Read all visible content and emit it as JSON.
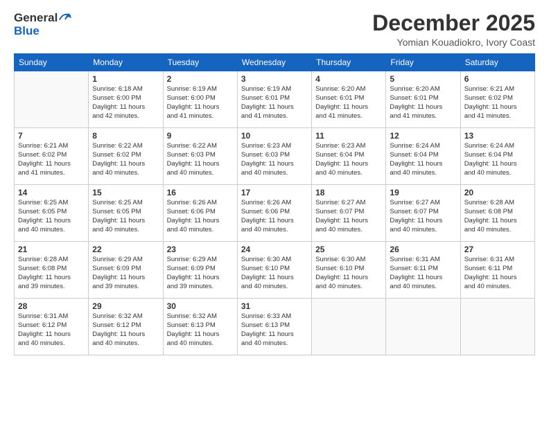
{
  "header": {
    "logo_line1": "General",
    "logo_line2": "Blue",
    "month_title": "December 2025",
    "location": "Yomian Kouadiokro, Ivory Coast"
  },
  "days_of_week": [
    "Sunday",
    "Monday",
    "Tuesday",
    "Wednesday",
    "Thursday",
    "Friday",
    "Saturday"
  ],
  "weeks": [
    [
      {
        "day": "",
        "info": ""
      },
      {
        "day": "1",
        "info": "Sunrise: 6:18 AM\nSunset: 6:00 PM\nDaylight: 11 hours\nand 42 minutes."
      },
      {
        "day": "2",
        "info": "Sunrise: 6:19 AM\nSunset: 6:00 PM\nDaylight: 11 hours\nand 41 minutes."
      },
      {
        "day": "3",
        "info": "Sunrise: 6:19 AM\nSunset: 6:01 PM\nDaylight: 11 hours\nand 41 minutes."
      },
      {
        "day": "4",
        "info": "Sunrise: 6:20 AM\nSunset: 6:01 PM\nDaylight: 11 hours\nand 41 minutes."
      },
      {
        "day": "5",
        "info": "Sunrise: 6:20 AM\nSunset: 6:01 PM\nDaylight: 11 hours\nand 41 minutes."
      },
      {
        "day": "6",
        "info": "Sunrise: 6:21 AM\nSunset: 6:02 PM\nDaylight: 11 hours\nand 41 minutes."
      }
    ],
    [
      {
        "day": "7",
        "info": "Sunrise: 6:21 AM\nSunset: 6:02 PM\nDaylight: 11 hours\nand 41 minutes."
      },
      {
        "day": "8",
        "info": "Sunrise: 6:22 AM\nSunset: 6:02 PM\nDaylight: 11 hours\nand 40 minutes."
      },
      {
        "day": "9",
        "info": "Sunrise: 6:22 AM\nSunset: 6:03 PM\nDaylight: 11 hours\nand 40 minutes."
      },
      {
        "day": "10",
        "info": "Sunrise: 6:23 AM\nSunset: 6:03 PM\nDaylight: 11 hours\nand 40 minutes."
      },
      {
        "day": "11",
        "info": "Sunrise: 6:23 AM\nSunset: 6:04 PM\nDaylight: 11 hours\nand 40 minutes."
      },
      {
        "day": "12",
        "info": "Sunrise: 6:24 AM\nSunset: 6:04 PM\nDaylight: 11 hours\nand 40 minutes."
      },
      {
        "day": "13",
        "info": "Sunrise: 6:24 AM\nSunset: 6:04 PM\nDaylight: 11 hours\nand 40 minutes."
      }
    ],
    [
      {
        "day": "14",
        "info": "Sunrise: 6:25 AM\nSunset: 6:05 PM\nDaylight: 11 hours\nand 40 minutes."
      },
      {
        "day": "15",
        "info": "Sunrise: 6:25 AM\nSunset: 6:05 PM\nDaylight: 11 hours\nand 40 minutes."
      },
      {
        "day": "16",
        "info": "Sunrise: 6:26 AM\nSunset: 6:06 PM\nDaylight: 11 hours\nand 40 minutes."
      },
      {
        "day": "17",
        "info": "Sunrise: 6:26 AM\nSunset: 6:06 PM\nDaylight: 11 hours\nand 40 minutes."
      },
      {
        "day": "18",
        "info": "Sunrise: 6:27 AM\nSunset: 6:07 PM\nDaylight: 11 hours\nand 40 minutes."
      },
      {
        "day": "19",
        "info": "Sunrise: 6:27 AM\nSunset: 6:07 PM\nDaylight: 11 hours\nand 40 minutes."
      },
      {
        "day": "20",
        "info": "Sunrise: 6:28 AM\nSunset: 6:08 PM\nDaylight: 11 hours\nand 40 minutes."
      }
    ],
    [
      {
        "day": "21",
        "info": "Sunrise: 6:28 AM\nSunset: 6:08 PM\nDaylight: 11 hours\nand 39 minutes."
      },
      {
        "day": "22",
        "info": "Sunrise: 6:29 AM\nSunset: 6:09 PM\nDaylight: 11 hours\nand 39 minutes."
      },
      {
        "day": "23",
        "info": "Sunrise: 6:29 AM\nSunset: 6:09 PM\nDaylight: 11 hours\nand 39 minutes."
      },
      {
        "day": "24",
        "info": "Sunrise: 6:30 AM\nSunset: 6:10 PM\nDaylight: 11 hours\nand 40 minutes."
      },
      {
        "day": "25",
        "info": "Sunrise: 6:30 AM\nSunset: 6:10 PM\nDaylight: 11 hours\nand 40 minutes."
      },
      {
        "day": "26",
        "info": "Sunrise: 6:31 AM\nSunset: 6:11 PM\nDaylight: 11 hours\nand 40 minutes."
      },
      {
        "day": "27",
        "info": "Sunrise: 6:31 AM\nSunset: 6:11 PM\nDaylight: 11 hours\nand 40 minutes."
      }
    ],
    [
      {
        "day": "28",
        "info": "Sunrise: 6:31 AM\nSunset: 6:12 PM\nDaylight: 11 hours\nand 40 minutes."
      },
      {
        "day": "29",
        "info": "Sunrise: 6:32 AM\nSunset: 6:12 PM\nDaylight: 11 hours\nand 40 minutes."
      },
      {
        "day": "30",
        "info": "Sunrise: 6:32 AM\nSunset: 6:13 PM\nDaylight: 11 hours\nand 40 minutes."
      },
      {
        "day": "31",
        "info": "Sunrise: 6:33 AM\nSunset: 6:13 PM\nDaylight: 11 hours\nand 40 minutes."
      },
      {
        "day": "",
        "info": ""
      },
      {
        "day": "",
        "info": ""
      },
      {
        "day": "",
        "info": ""
      }
    ]
  ]
}
